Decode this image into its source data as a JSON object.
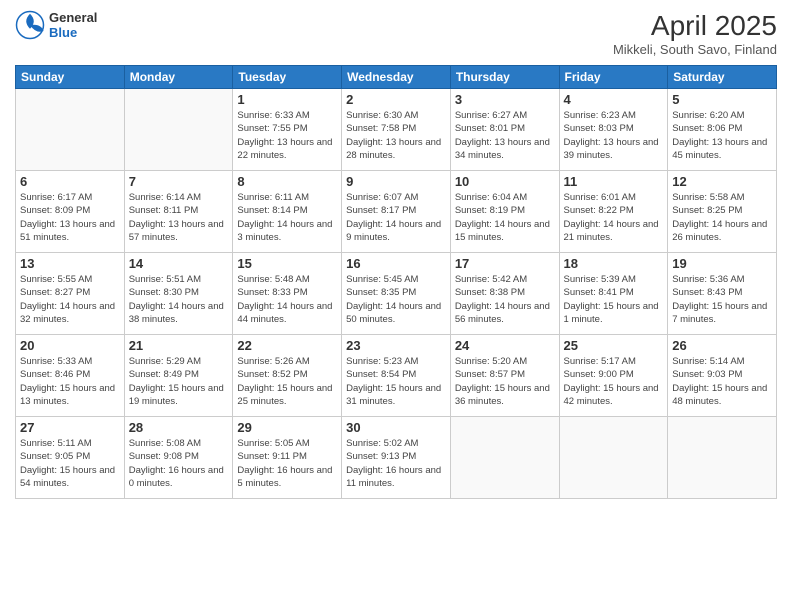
{
  "header": {
    "logo": {
      "general": "General",
      "blue": "Blue"
    },
    "title": "April 2025",
    "location": "Mikkeli, South Savo, Finland"
  },
  "days_of_week": [
    "Sunday",
    "Monday",
    "Tuesday",
    "Wednesday",
    "Thursday",
    "Friday",
    "Saturday"
  ],
  "weeks": [
    [
      {
        "day": null
      },
      {
        "day": null
      },
      {
        "day": 1,
        "sunrise": "Sunrise: 6:33 AM",
        "sunset": "Sunset: 7:55 PM",
        "daylight": "Daylight: 13 hours and 22 minutes."
      },
      {
        "day": 2,
        "sunrise": "Sunrise: 6:30 AM",
        "sunset": "Sunset: 7:58 PM",
        "daylight": "Daylight: 13 hours and 28 minutes."
      },
      {
        "day": 3,
        "sunrise": "Sunrise: 6:27 AM",
        "sunset": "Sunset: 8:01 PM",
        "daylight": "Daylight: 13 hours and 34 minutes."
      },
      {
        "day": 4,
        "sunrise": "Sunrise: 6:23 AM",
        "sunset": "Sunset: 8:03 PM",
        "daylight": "Daylight: 13 hours and 39 minutes."
      },
      {
        "day": 5,
        "sunrise": "Sunrise: 6:20 AM",
        "sunset": "Sunset: 8:06 PM",
        "daylight": "Daylight: 13 hours and 45 minutes."
      }
    ],
    [
      {
        "day": 6,
        "sunrise": "Sunrise: 6:17 AM",
        "sunset": "Sunset: 8:09 PM",
        "daylight": "Daylight: 13 hours and 51 minutes."
      },
      {
        "day": 7,
        "sunrise": "Sunrise: 6:14 AM",
        "sunset": "Sunset: 8:11 PM",
        "daylight": "Daylight: 13 hours and 57 minutes."
      },
      {
        "day": 8,
        "sunrise": "Sunrise: 6:11 AM",
        "sunset": "Sunset: 8:14 PM",
        "daylight": "Daylight: 14 hours and 3 minutes."
      },
      {
        "day": 9,
        "sunrise": "Sunrise: 6:07 AM",
        "sunset": "Sunset: 8:17 PM",
        "daylight": "Daylight: 14 hours and 9 minutes."
      },
      {
        "day": 10,
        "sunrise": "Sunrise: 6:04 AM",
        "sunset": "Sunset: 8:19 PM",
        "daylight": "Daylight: 14 hours and 15 minutes."
      },
      {
        "day": 11,
        "sunrise": "Sunrise: 6:01 AM",
        "sunset": "Sunset: 8:22 PM",
        "daylight": "Daylight: 14 hours and 21 minutes."
      },
      {
        "day": 12,
        "sunrise": "Sunrise: 5:58 AM",
        "sunset": "Sunset: 8:25 PM",
        "daylight": "Daylight: 14 hours and 26 minutes."
      }
    ],
    [
      {
        "day": 13,
        "sunrise": "Sunrise: 5:55 AM",
        "sunset": "Sunset: 8:27 PM",
        "daylight": "Daylight: 14 hours and 32 minutes."
      },
      {
        "day": 14,
        "sunrise": "Sunrise: 5:51 AM",
        "sunset": "Sunset: 8:30 PM",
        "daylight": "Daylight: 14 hours and 38 minutes."
      },
      {
        "day": 15,
        "sunrise": "Sunrise: 5:48 AM",
        "sunset": "Sunset: 8:33 PM",
        "daylight": "Daylight: 14 hours and 44 minutes."
      },
      {
        "day": 16,
        "sunrise": "Sunrise: 5:45 AM",
        "sunset": "Sunset: 8:35 PM",
        "daylight": "Daylight: 14 hours and 50 minutes."
      },
      {
        "day": 17,
        "sunrise": "Sunrise: 5:42 AM",
        "sunset": "Sunset: 8:38 PM",
        "daylight": "Daylight: 14 hours and 56 minutes."
      },
      {
        "day": 18,
        "sunrise": "Sunrise: 5:39 AM",
        "sunset": "Sunset: 8:41 PM",
        "daylight": "Daylight: 15 hours and 1 minute."
      },
      {
        "day": 19,
        "sunrise": "Sunrise: 5:36 AM",
        "sunset": "Sunset: 8:43 PM",
        "daylight": "Daylight: 15 hours and 7 minutes."
      }
    ],
    [
      {
        "day": 20,
        "sunrise": "Sunrise: 5:33 AM",
        "sunset": "Sunset: 8:46 PM",
        "daylight": "Daylight: 15 hours and 13 minutes."
      },
      {
        "day": 21,
        "sunrise": "Sunrise: 5:29 AM",
        "sunset": "Sunset: 8:49 PM",
        "daylight": "Daylight: 15 hours and 19 minutes."
      },
      {
        "day": 22,
        "sunrise": "Sunrise: 5:26 AM",
        "sunset": "Sunset: 8:52 PM",
        "daylight": "Daylight: 15 hours and 25 minutes."
      },
      {
        "day": 23,
        "sunrise": "Sunrise: 5:23 AM",
        "sunset": "Sunset: 8:54 PM",
        "daylight": "Daylight: 15 hours and 31 minutes."
      },
      {
        "day": 24,
        "sunrise": "Sunrise: 5:20 AM",
        "sunset": "Sunset: 8:57 PM",
        "daylight": "Daylight: 15 hours and 36 minutes."
      },
      {
        "day": 25,
        "sunrise": "Sunrise: 5:17 AM",
        "sunset": "Sunset: 9:00 PM",
        "daylight": "Daylight: 15 hours and 42 minutes."
      },
      {
        "day": 26,
        "sunrise": "Sunrise: 5:14 AM",
        "sunset": "Sunset: 9:03 PM",
        "daylight": "Daylight: 15 hours and 48 minutes."
      }
    ],
    [
      {
        "day": 27,
        "sunrise": "Sunrise: 5:11 AM",
        "sunset": "Sunset: 9:05 PM",
        "daylight": "Daylight: 15 hours and 54 minutes."
      },
      {
        "day": 28,
        "sunrise": "Sunrise: 5:08 AM",
        "sunset": "Sunset: 9:08 PM",
        "daylight": "Daylight: 16 hours and 0 minutes."
      },
      {
        "day": 29,
        "sunrise": "Sunrise: 5:05 AM",
        "sunset": "Sunset: 9:11 PM",
        "daylight": "Daylight: 16 hours and 5 minutes."
      },
      {
        "day": 30,
        "sunrise": "Sunrise: 5:02 AM",
        "sunset": "Sunset: 9:13 PM",
        "daylight": "Daylight: 16 hours and 11 minutes."
      },
      {
        "day": null
      },
      {
        "day": null
      },
      {
        "day": null
      }
    ]
  ]
}
